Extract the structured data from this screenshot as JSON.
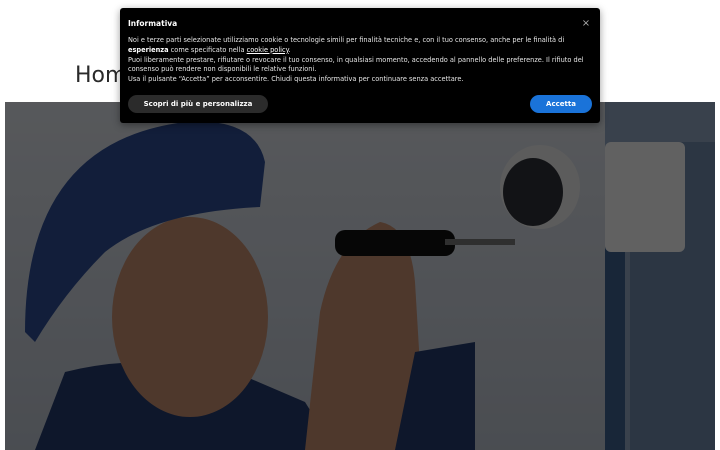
{
  "page": {
    "heading": "Hom"
  },
  "hero": {
    "alt": "technician-inspecting-security-camera-photo"
  },
  "cookie_banner": {
    "title": "Informativa",
    "close_icon": "×",
    "line1_a": "Noi e terze parti selezionate utilizziamo cookie o tecnologie simili per finalità tecniche e, con il tuo consenso, anche per le finalità di ",
    "line1_bold": "esperienza",
    "line1_b": " come specificato nella ",
    "line1_link": "cookie policy",
    "line1_end": ".",
    "line2": "Puoi liberamente prestare, rifiutare o revocare il tuo consenso, in qualsiasi momento, accedendo al pannello delle preferenze. Il rifiuto del consenso può rendere non disponibili le relative funzioni.",
    "line3": "Usa il pulsante “Accetta” per acconsentire. Chiudi questa informativa per continuare senza accettare.",
    "more_button": "Scopri di più e personalizza",
    "accept_button": "Accetta"
  },
  "colors": {
    "banner_bg": "#000000",
    "accept_bg": "#1a73d9",
    "more_bg": "#2b2b2b"
  }
}
